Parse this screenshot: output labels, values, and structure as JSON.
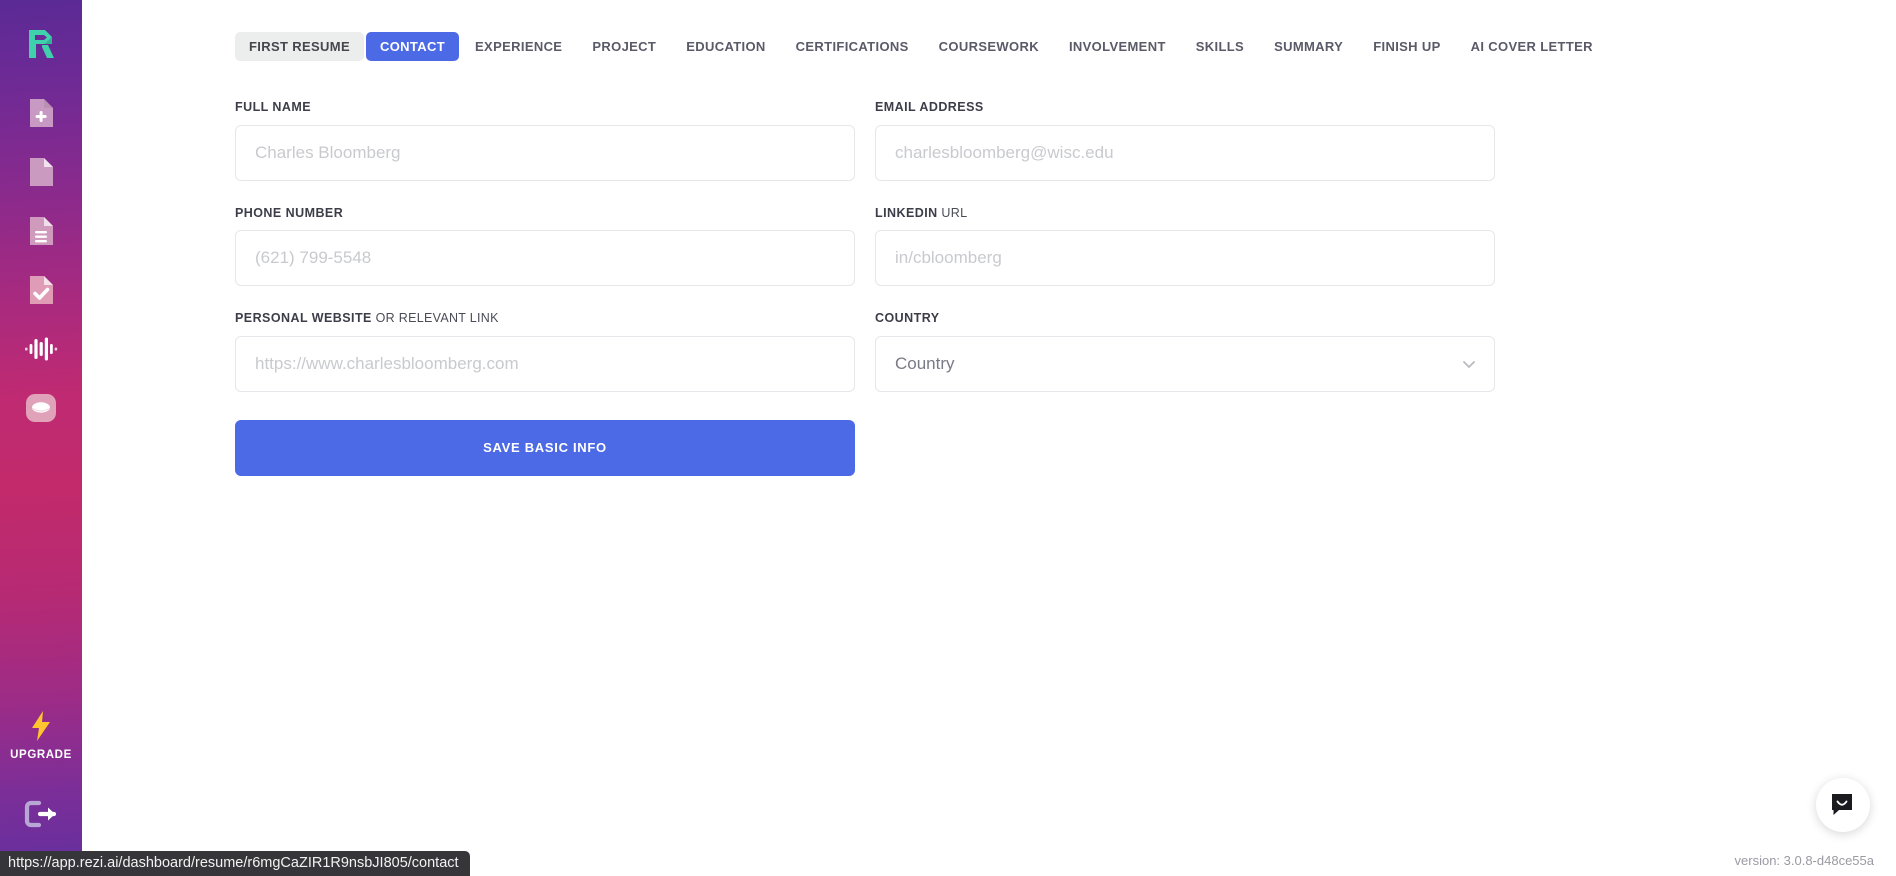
{
  "sidebar": {
    "logo": {
      "name": "rezi-logo",
      "letter": "R",
      "color": "#3fd0ac"
    },
    "items": [
      {
        "icon": "document-add-icon",
        "label": "New Resume"
      },
      {
        "icon": "document-blank-icon",
        "label": "Resume"
      },
      {
        "icon": "document-lines-icon",
        "label": "Documents"
      },
      {
        "icon": "document-check-icon",
        "label": "Review"
      },
      {
        "icon": "waveform-icon",
        "label": "Analytics"
      },
      {
        "icon": "badge-oval-icon",
        "label": "Account"
      }
    ],
    "upgrade": {
      "icon": "lightning-bolt-icon",
      "label": "UPGRADE",
      "color": "#ffc52e"
    },
    "logout": {
      "icon": "logout-icon",
      "label": "Log out"
    }
  },
  "tabs": [
    {
      "label": "FIRST RESUME",
      "state": "grey"
    },
    {
      "label": "CONTACT",
      "state": "active"
    },
    {
      "label": "EXPERIENCE",
      "state": "normal"
    },
    {
      "label": "PROJECT",
      "state": "normal"
    },
    {
      "label": "EDUCATION",
      "state": "normal"
    },
    {
      "label": "CERTIFICATIONS",
      "state": "normal"
    },
    {
      "label": "COURSEWORK",
      "state": "normal"
    },
    {
      "label": "INVOLVEMENT",
      "state": "normal"
    },
    {
      "label": "SKILLS",
      "state": "normal"
    },
    {
      "label": "SUMMARY",
      "state": "normal"
    },
    {
      "label": "FINISH UP",
      "state": "normal"
    },
    {
      "label": "AI COVER LETTER",
      "state": "normal"
    }
  ],
  "form": {
    "full_name": {
      "label": "FULL NAME",
      "label_sub": "",
      "placeholder": "Charles Bloomberg",
      "value": ""
    },
    "email": {
      "label": "EMAIL ADDRESS",
      "label_sub": "",
      "placeholder": "charlesbloomberg@wisc.edu",
      "value": ""
    },
    "phone": {
      "label": "PHONE NUMBER",
      "label_sub": "",
      "placeholder": "(621) 799-5548",
      "value": ""
    },
    "linkedin": {
      "label": "LINKEDIN",
      "label_sub": " URL",
      "placeholder": "in/cbloomberg",
      "value": ""
    },
    "website": {
      "label": "PERSONAL WEBSITE",
      "label_sub": " OR RELEVANT LINK",
      "placeholder": "https://www.charlesbloomberg.com",
      "value": ""
    },
    "country": {
      "label": "COUNTRY",
      "label_sub": "",
      "selected": "Country",
      "caret": "chevron-down-icon"
    },
    "save_button": "SAVE BASIC INFO"
  },
  "footer": {
    "version": "version: 3.0.8-d48ce55a",
    "status_url": "https://app.rezi.ai/dashboard/resume/r6mgCaZIR1R9nsbJI805/contact"
  },
  "chat": {
    "icon": "chat-bubble-icon",
    "label": "Open chat"
  },
  "colors": {
    "accent": "#4c6ae5",
    "tab_inactive_bg": "#eceded",
    "logo_green": "#3fd0ac",
    "upgrade_yellow": "#ffc52e",
    "input_border": "#e6e7ea",
    "placeholder": "#c9cace"
  }
}
